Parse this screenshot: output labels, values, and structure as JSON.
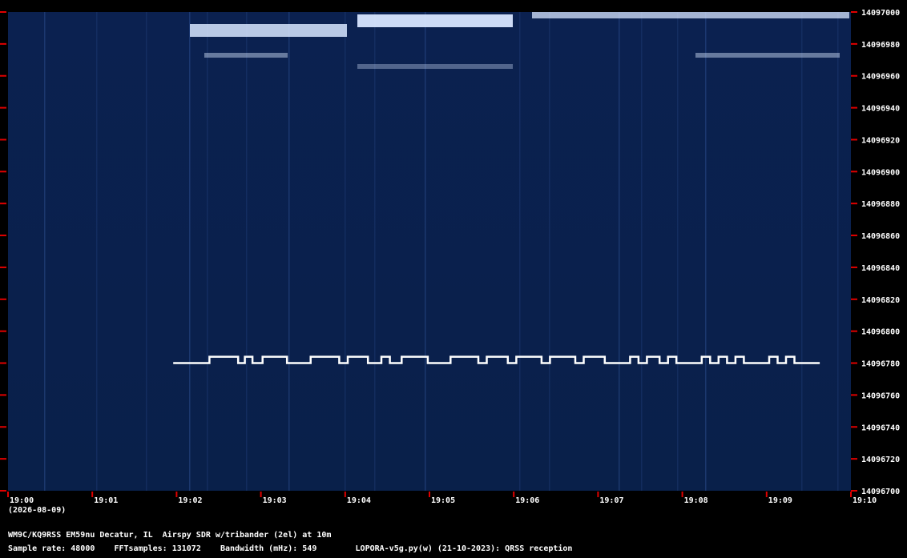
{
  "header": {
    "station": "WM9C/KQ9RSS EM59nu Decatur, IL  Airspy SDR w/tribander (2el) at 10m",
    "sample_rate": "Sample rate: 48000",
    "fft_samples": "FFTsamples: 131072",
    "bandwidth": "Bandwidth (mHz): 549",
    "software": "LOPORA-v5g.py(w) (21-10-2023): QRSS reception"
  },
  "colors": {
    "background": "#0a1f4a",
    "signal": "#ffffff",
    "tick": "#e00000",
    "text": "#ffffff"
  },
  "chart_data": {
    "type": "heatmap",
    "title": "",
    "xlabel": "",
    "ylabel": "",
    "date_label": "(2026-08-09)",
    "x_ticks": [
      "19:00",
      "19:01",
      "19:02",
      "19:03",
      "19:04",
      "19:05",
      "19:06",
      "19:07",
      "19:08",
      "19:09",
      "19:10"
    ],
    "y_ticks": [
      14097000,
      14096980,
      14096960,
      14096940,
      14096920,
      14096900,
      14096880,
      14096860,
      14096840,
      14096820,
      14096800,
      14096780,
      14096760,
      14096740,
      14096720,
      14096700
    ],
    "xlim": [
      "19:00",
      "19:10"
    ],
    "ylim": [
      14096700,
      14097000
    ],
    "grid": false,
    "series": [
      {
        "values": [
          [
            "19:01.96",
            14096780
          ],
          [
            "19:02.39",
            14096780
          ],
          [
            "19:02.39",
            14096784
          ],
          [
            "19:02.73",
            14096784
          ],
          [
            "19:02.73",
            14096780
          ],
          [
            "19:02.81",
            14096780
          ],
          [
            "19:02.81",
            14096784
          ],
          [
            "19:02.90",
            14096784
          ],
          [
            "19:02.90",
            14096780
          ],
          [
            "19:03.02",
            14096780
          ],
          [
            "19:03.02",
            14096784
          ],
          [
            "19:03.31",
            14096784
          ],
          [
            "19:03.31",
            14096780
          ],
          [
            "19:03.59",
            14096780
          ],
          [
            "19:03.59",
            14096784
          ],
          [
            "19:03.93",
            14096784
          ],
          [
            "19:03.93",
            14096780
          ],
          [
            "19:04.03",
            14096780
          ],
          [
            "19:04.03",
            14096784
          ],
          [
            "19:04.27",
            14096784
          ],
          [
            "19:04.27",
            14096780
          ],
          [
            "19:04.43",
            14096780
          ],
          [
            "19:04.43",
            14096784
          ],
          [
            "19:04.53",
            14096784
          ],
          [
            "19:04.53",
            14096780
          ],
          [
            "19:04.67",
            14096780
          ],
          [
            "19:04.67",
            14096784
          ],
          [
            "19:04.98",
            14096784
          ],
          [
            "19:04.98",
            14096780
          ],
          [
            "19:05.25",
            14096780
          ],
          [
            "19:05.25",
            14096784
          ],
          [
            "19:05.58",
            14096784
          ],
          [
            "19:05.58",
            14096780
          ],
          [
            "19:05.68",
            14096780
          ],
          [
            "19:05.68",
            14096784
          ],
          [
            "19:05.93",
            14096784
          ],
          [
            "19:05.93",
            14096780
          ],
          [
            "19:06.03",
            14096780
          ],
          [
            "19:06.03",
            14096784
          ],
          [
            "19:06.33",
            14096784
          ],
          [
            "19:06.33",
            14096780
          ],
          [
            "19:06.43",
            14096780
          ],
          [
            "19:06.43",
            14096784
          ],
          [
            "19:06.73",
            14096784
          ],
          [
            "19:06.73",
            14096780
          ],
          [
            "19:06.83",
            14096780
          ],
          [
            "19:06.83",
            14096784
          ],
          [
            "19:07.08",
            14096784
          ],
          [
            "19:07.08",
            14096780
          ],
          [
            "19:07.38",
            14096780
          ],
          [
            "19:07.38",
            14096784
          ],
          [
            "19:07.48",
            14096784
          ],
          [
            "19:07.48",
            14096780
          ],
          [
            "19:07.58",
            14096780
          ],
          [
            "19:07.58",
            14096784
          ],
          [
            "19:07.73",
            14096784
          ],
          [
            "19:07.73",
            14096780
          ],
          [
            "19:07.83",
            14096780
          ],
          [
            "19:07.83",
            14096784
          ],
          [
            "19:07.93",
            14096784
          ],
          [
            "19:07.93",
            14096780
          ],
          [
            "19:08.23",
            14096780
          ],
          [
            "19:08.23",
            14096784
          ],
          [
            "19:08.33",
            14096784
          ],
          [
            "19:08.33",
            14096780
          ],
          [
            "19:08.43",
            14096780
          ],
          [
            "19:08.43",
            14096784
          ],
          [
            "19:08.53",
            14096784
          ],
          [
            "19:08.53",
            14096780
          ],
          [
            "19:08.63",
            14096780
          ],
          [
            "19:08.63",
            14096784
          ],
          [
            "19:08.73",
            14096784
          ],
          [
            "19:08.73",
            14096780
          ],
          [
            "19:09.03",
            14096780
          ],
          [
            "19:09.03",
            14096784
          ],
          [
            "19:09.13",
            14096784
          ],
          [
            "19:09.13",
            14096780
          ],
          [
            "19:09.23",
            14096780
          ],
          [
            "19:09.23",
            14096784
          ],
          [
            "19:09.33",
            14096784
          ],
          [
            "19:09.33",
            14096780
          ],
          [
            "19:09.63",
            14096780
          ]
        ]
      }
    ]
  }
}
